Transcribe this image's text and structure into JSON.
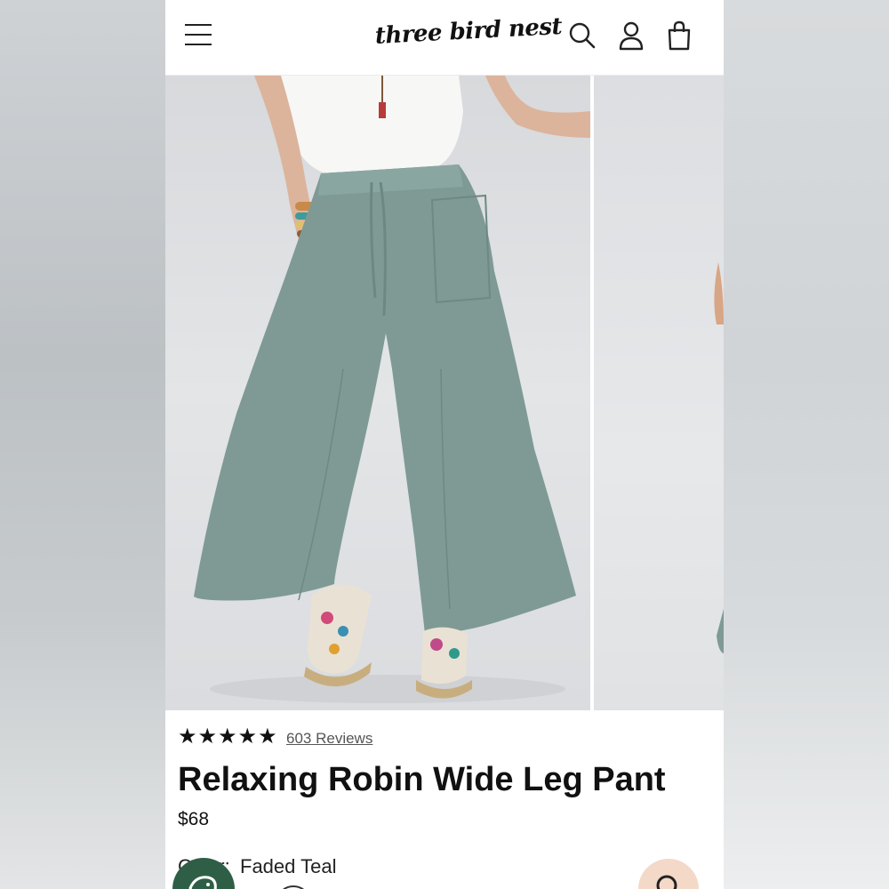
{
  "header": {
    "logo_text": "three bird nest",
    "icons": [
      "menu-icon",
      "search-icon",
      "account-icon",
      "cart-icon"
    ]
  },
  "gallery": {
    "images": [
      "product-photo-front",
      "product-photo-next"
    ]
  },
  "product": {
    "stars": "★★★★★",
    "rating": 5,
    "reviews_link": "603 Reviews",
    "title": "Relaxing Robin Wide Leg Pant",
    "price": "$68",
    "color_label": "Color:",
    "color_value": "Faded Teal"
  },
  "colors": {
    "pant": "#7f9a95",
    "chat_bubble": "#2f5e47",
    "search_fab": "#f4d8c8"
  }
}
